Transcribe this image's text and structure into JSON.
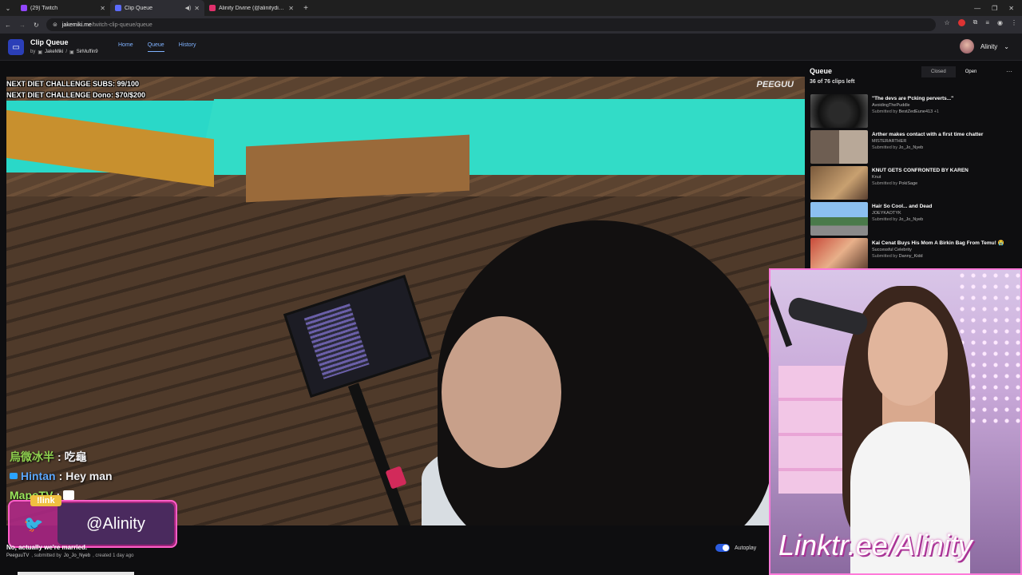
{
  "browser": {
    "tabs": [
      {
        "title": "(29) Twitch",
        "color": "#9146ff"
      },
      {
        "title": "Clip Queue",
        "color": "#5c6bff"
      },
      {
        "title": "Alinity Divine (@alinitydivine) -",
        "color": "#e1306c"
      }
    ],
    "url_host": "jakemiki.me",
    "url_path": "/twitch-clip-queue/queue"
  },
  "app": {
    "title": "Clip Queue",
    "by_label": "by",
    "author1": "JakeMiki",
    "separator": "/",
    "author2": "SirMuffin9",
    "nav": [
      "Home",
      "Queue",
      "History"
    ],
    "user_name": "Alinity"
  },
  "video": {
    "overlay_line1": "NEXT DIET CHALLENGE SUBS: 99/100",
    "overlay_line2": "NEXT DIET CHALLENGE Dono: $70/$200",
    "cam_logo": "PEEGUU",
    "chat": [
      {
        "user": "烏微冰半",
        "message": "吃龜"
      },
      {
        "user": "Hintan",
        "message": "Hey man"
      },
      {
        "user": "MapoTV",
        "message": ""
      }
    ],
    "social_tag": "!link",
    "social_handle": "@Alinity"
  },
  "clip": {
    "title": "No, actually we're married.",
    "channel": "PeeguuTV",
    "submitted_label": ", submitted by",
    "submitter": "Jo_Jo_Nyeb",
    "created": ", created 1 day ago",
    "autoplay_label": "Autoplay",
    "autoplay_on": true
  },
  "queue": {
    "title": "Queue",
    "count": "36 of 76 clips left",
    "tab_closed": "Closed",
    "tab_open": "Open",
    "items": [
      {
        "title": "\"The devs are f*cking perverts...\"",
        "channel": "AvoidingThePuddle",
        "submitted": "Submitted by",
        "submitter": "BestZedEune413",
        "extra": "+1",
        "thumb": "#1a1a1a"
      },
      {
        "title": "Arther makes contact with a first time chatter",
        "channel": "MISTERARTHER",
        "submitted": "Submitted by",
        "submitter": "Jo_Jo_Nyeb",
        "extra": "",
        "thumb": "#8a7e74"
      },
      {
        "title": "KNUT GETS CONFRONTED BY KAREN",
        "channel": "Knut",
        "submitted": "Submitted by",
        "submitter": "PokiSage",
        "extra": "",
        "thumb": "#a07e5c"
      },
      {
        "title": "Hair So Cool... and Dead",
        "channel": "JOEYKAOTYK",
        "submitted": "Submitted by",
        "submitter": "Jo_Jo_Nyeb",
        "extra": "",
        "thumb": "#5a8ac2"
      },
      {
        "title": "Kai Cenat Buys His Mom A Birkin Bag From Temu! 😭",
        "channel": "Successful Celebrity",
        "submitted": "Submitted by",
        "submitter": "Danny_Kidd",
        "extra": "",
        "thumb": "#b25a4a"
      }
    ]
  },
  "webcam": {
    "link_text": "Linktr.ee/Alinity"
  },
  "colors": {
    "accent": "#7fb2ff",
    "brand": "#2b3fb8",
    "overlay_border": "#ff7ad9"
  }
}
